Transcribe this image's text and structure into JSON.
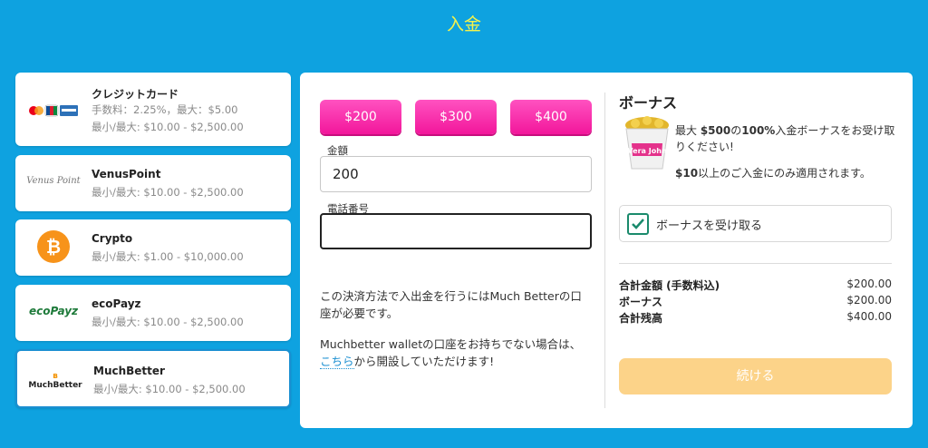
{
  "page": {
    "title": "入金"
  },
  "methods": [
    {
      "name": "クレジットカード",
      "fee": "手数料：2.25%，最大：$5.00",
      "limits": "最小/最大: $10.00 - $2,500.00",
      "icon": "credit-card-logos"
    },
    {
      "name": "VenusPoint",
      "limits": "最小/最大: $10.00 - $2,500.00",
      "icon": "venuspoint-logo",
      "logo_text": "Venus Point"
    },
    {
      "name": "Crypto",
      "limits": "最小/最大: $1.00 - $10,000.00",
      "icon": "bitcoin-icon",
      "logo_text": "₿"
    },
    {
      "name": "ecoPayz",
      "limits": "最小/最大: $10.00 - $2,500.00",
      "icon": "ecopayz-logo",
      "logo_text": "ecoPayz"
    },
    {
      "name": "MuchBetter",
      "limits": "最小/最大: $10.00 - $2,500.00",
      "icon": "muchbetter-logo",
      "logo_text": "MuchBetter",
      "selected": true
    }
  ],
  "amount_buttons": [
    "$200",
    "$300",
    "$400"
  ],
  "form": {
    "amount_label": "金額",
    "amount_value": "200",
    "phone_label": "電話番号",
    "phone_value": ""
  },
  "info": {
    "line1": "この決済方法で入出金を行うにはMuch Betterの口座が必要です。",
    "line2_prefix": "Muchbetter walletの口座をお持ちでない場合は、",
    "link": "こちら",
    "line2_suffix": "から開設していただけます!"
  },
  "bonus": {
    "title": "ボーナス",
    "text_pre": "最大 ",
    "text_amount": "$500",
    "text_mid": "の",
    "text_pct": "100%",
    "text_post": "入金ボーナスをお受け取りください!",
    "note_amount": "$10",
    "note_post": "以上のご入金にのみ適用されます。",
    "bucket_text": "Vera John",
    "checkbox_label": "ボーナスを受け取る",
    "checked": true
  },
  "summary": [
    {
      "label": "合計金額 (手数料込)",
      "value": "$200.00"
    },
    {
      "label": "ボーナス",
      "value": "$200.00"
    },
    {
      "label": "合計残高",
      "value": "$400.00"
    }
  ],
  "continue_label": "続ける",
  "colors": {
    "background": "#0ea2e0",
    "title": "#f6f34a",
    "pink": "#f2169b",
    "continue": "#fcd389",
    "check": "#1a8a6c"
  }
}
